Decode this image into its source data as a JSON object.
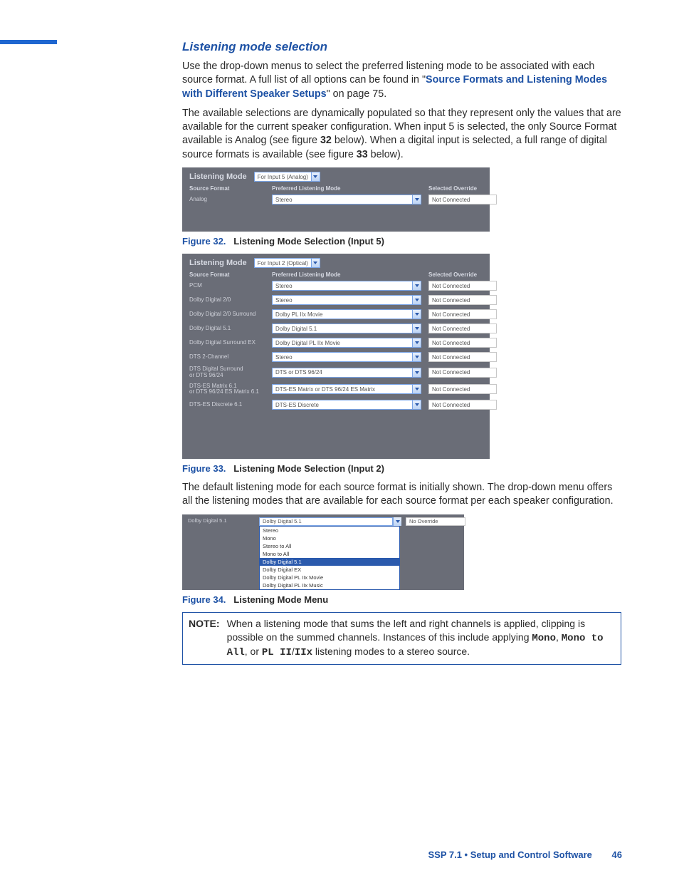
{
  "section_title": "Listening mode selection",
  "para1_a": "Use the drop-down menus to select the preferred listening mode to be associated with each source format. A full list of all options can be found in \"",
  "link1": "Source Formats and Listening Modes with Different Speaker Setups",
  "para1_b": "\" on page 75.",
  "para2_a": "The available selections are dynamically populated so that they represent only the values that are available for the current speaker configuration. When input 5 is selected, the only Source Format available is Analog (see figure ",
  "para2_fig32": "32",
  "para2_b": " below). When a digital input is selected, a full range of digital source formats is available (see figure ",
  "para2_fig33": "33",
  "para2_c": " below).",
  "panel": {
    "title": "Listening Mode",
    "col_src": "Source Format",
    "col_pref": "Preferred Listening Mode",
    "col_ovr": "Selected Override"
  },
  "fig32": {
    "caption_num": "Figure 32.",
    "caption_title": "Listening Mode Selection (Input 5)",
    "input_dd": "For Input 5 (Analog)",
    "rows": [
      {
        "src": "Analog",
        "pref": "Stereo",
        "ovr": "Not Connected"
      }
    ]
  },
  "fig33": {
    "caption_num": "Figure 33.",
    "caption_title": "Listening Mode Selection (Input 2)",
    "input_dd": "For Input 2 (Optical)",
    "rows": [
      {
        "src": "PCM",
        "pref": "Stereo",
        "ovr": "Not Connected"
      },
      {
        "src": "Dolby Digital 2/0",
        "pref": "Stereo",
        "ovr": "Not Connected"
      },
      {
        "src": "Dolby Digital 2/0 Surround",
        "pref": "Dolby PL IIx Movie",
        "ovr": "Not Connected"
      },
      {
        "src": "Dolby Digital 5.1",
        "pref": "Dolby Digital 5.1",
        "ovr": "Not Connected"
      },
      {
        "src": "Dolby Digital Surround EX",
        "pref": "Dolby Digital PL IIx Movie",
        "ovr": "Not Connected"
      },
      {
        "src": "DTS 2-Channel",
        "pref": "Stereo",
        "ovr": "Not Connected"
      },
      {
        "src": "DTS Digital Surround\nor DTS 96/24",
        "pref": "DTS or DTS 96/24",
        "ovr": "Not Connected"
      },
      {
        "src": "DTS-ES Matrix 6.1\nor DTS 96/24 ES Matrix 6.1",
        "pref": "DTS-ES Matrix or DTS 96/24 ES Matrix",
        "ovr": "Not Connected"
      },
      {
        "src": "DTS-ES Discrete 6.1",
        "pref": "DTS-ES Discrete",
        "ovr": "Not Connected"
      }
    ]
  },
  "para3": "The default listening mode for each source format is initially shown. The drop-down menu offers all the listening modes that are available for each source format per each speaker configuration.",
  "fig34": {
    "caption_num": "Figure 34.",
    "caption_title": "Listening Mode Menu",
    "src": "Dolby Digital 5.1",
    "pref": "Dolby Digital 5.1",
    "ovr": "No Override",
    "options": [
      "Stereo",
      "Mono",
      "Stereo to All",
      "Mono to All",
      "Dolby Digital 5.1",
      "Dolby Digital EX",
      "Dolby Digital PL IIx Movie",
      "Dolby Digital PL IIx Music"
    ],
    "highlight_index": 4
  },
  "note": {
    "label": "NOTE:",
    "a": "When a listening mode that sums the left and right channels is applied, clipping is possible on the summed channels. Instances of this include applying ",
    "m1": "Mono",
    "b": ", ",
    "m2": "Mono to All",
    "c": ", or ",
    "m3": "PL II",
    "slash": "/",
    "m4": "IIx",
    "d": " listening modes to a stereo source."
  },
  "footer": {
    "title": "SSP 7.1 • Setup and Control Software",
    "page": "46"
  }
}
